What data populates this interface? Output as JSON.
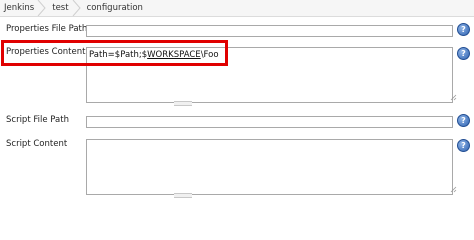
{
  "breadcrumb": {
    "items": [
      "Jenkins",
      "test",
      "configuration"
    ]
  },
  "fields": {
    "properties_file_path": {
      "label": "Properties File Path",
      "value": ""
    },
    "properties_content": {
      "label": "Properties Content",
      "value_prefix": "Path=$Path;$",
      "value_link": "WORKSPACE",
      "value_suffix": "\\Foo"
    },
    "script_file_path": {
      "label": "Script File Path",
      "value": ""
    },
    "script_content": {
      "label": "Script Content",
      "value": ""
    }
  },
  "help_glyph": "?",
  "icons": {
    "help": "help-icon",
    "resize": "resize-handle-icon",
    "separator": "breadcrumb-separator-icon"
  },
  "colors": {
    "highlight": "#e00000",
    "help": "#2e62b1"
  }
}
